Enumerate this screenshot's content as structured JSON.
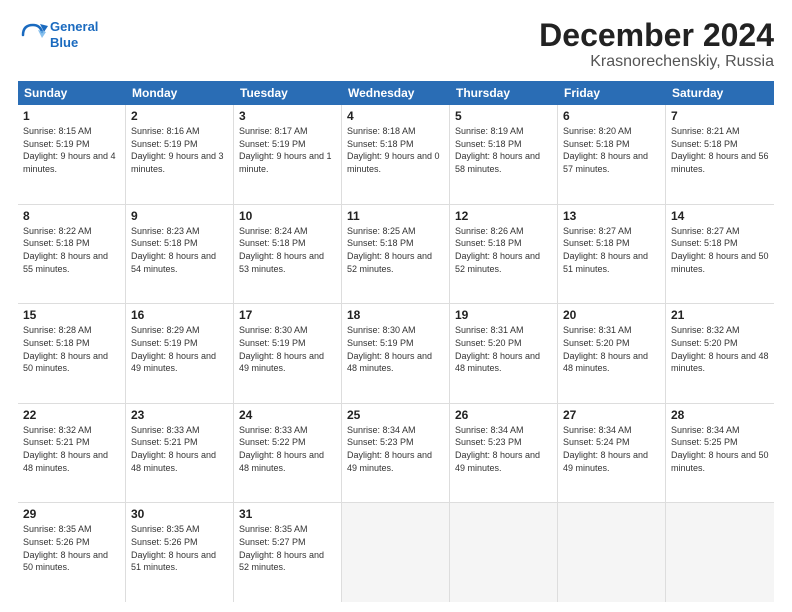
{
  "logo": {
    "line1": "General",
    "line2": "Blue"
  },
  "title": "December 2024",
  "subtitle": "Krasnorechenskiy, Russia",
  "header": {
    "days": [
      "Sunday",
      "Monday",
      "Tuesday",
      "Wednesday",
      "Thursday",
      "Friday",
      "Saturday"
    ]
  },
  "weeks": [
    [
      {
        "day": "1",
        "sunrise": "8:15 AM",
        "sunset": "5:19 PM",
        "daylight": "9 hours and 4 minutes."
      },
      {
        "day": "2",
        "sunrise": "8:16 AM",
        "sunset": "5:19 PM",
        "daylight": "9 hours and 3 minutes."
      },
      {
        "day": "3",
        "sunrise": "8:17 AM",
        "sunset": "5:19 PM",
        "daylight": "9 hours and 1 minute."
      },
      {
        "day": "4",
        "sunrise": "8:18 AM",
        "sunset": "5:18 PM",
        "daylight": "9 hours and 0 minutes."
      },
      {
        "day": "5",
        "sunrise": "8:19 AM",
        "sunset": "5:18 PM",
        "daylight": "8 hours and 58 minutes."
      },
      {
        "day": "6",
        "sunrise": "8:20 AM",
        "sunset": "5:18 PM",
        "daylight": "8 hours and 57 minutes."
      },
      {
        "day": "7",
        "sunrise": "8:21 AM",
        "sunset": "5:18 PM",
        "daylight": "8 hours and 56 minutes."
      }
    ],
    [
      {
        "day": "8",
        "sunrise": "8:22 AM",
        "sunset": "5:18 PM",
        "daylight": "8 hours and 55 minutes."
      },
      {
        "day": "9",
        "sunrise": "8:23 AM",
        "sunset": "5:18 PM",
        "daylight": "8 hours and 54 minutes."
      },
      {
        "day": "10",
        "sunrise": "8:24 AM",
        "sunset": "5:18 PM",
        "daylight": "8 hours and 53 minutes."
      },
      {
        "day": "11",
        "sunrise": "8:25 AM",
        "sunset": "5:18 PM",
        "daylight": "8 hours and 52 minutes."
      },
      {
        "day": "12",
        "sunrise": "8:26 AM",
        "sunset": "5:18 PM",
        "daylight": "8 hours and 52 minutes."
      },
      {
        "day": "13",
        "sunrise": "8:27 AM",
        "sunset": "5:18 PM",
        "daylight": "8 hours and 51 minutes."
      },
      {
        "day": "14",
        "sunrise": "8:27 AM",
        "sunset": "5:18 PM",
        "daylight": "8 hours and 50 minutes."
      }
    ],
    [
      {
        "day": "15",
        "sunrise": "8:28 AM",
        "sunset": "5:18 PM",
        "daylight": "8 hours and 50 minutes."
      },
      {
        "day": "16",
        "sunrise": "8:29 AM",
        "sunset": "5:19 PM",
        "daylight": "8 hours and 49 minutes."
      },
      {
        "day": "17",
        "sunrise": "8:30 AM",
        "sunset": "5:19 PM",
        "daylight": "8 hours and 49 minutes."
      },
      {
        "day": "18",
        "sunrise": "8:30 AM",
        "sunset": "5:19 PM",
        "daylight": "8 hours and 48 minutes."
      },
      {
        "day": "19",
        "sunrise": "8:31 AM",
        "sunset": "5:20 PM",
        "daylight": "8 hours and 48 minutes."
      },
      {
        "day": "20",
        "sunrise": "8:31 AM",
        "sunset": "5:20 PM",
        "daylight": "8 hours and 48 minutes."
      },
      {
        "day": "21",
        "sunrise": "8:32 AM",
        "sunset": "5:20 PM",
        "daylight": "8 hours and 48 minutes."
      }
    ],
    [
      {
        "day": "22",
        "sunrise": "8:32 AM",
        "sunset": "5:21 PM",
        "daylight": "8 hours and 48 minutes."
      },
      {
        "day": "23",
        "sunrise": "8:33 AM",
        "sunset": "5:21 PM",
        "daylight": "8 hours and 48 minutes."
      },
      {
        "day": "24",
        "sunrise": "8:33 AM",
        "sunset": "5:22 PM",
        "daylight": "8 hours and 48 minutes."
      },
      {
        "day": "25",
        "sunrise": "8:34 AM",
        "sunset": "5:23 PM",
        "daylight": "8 hours and 49 minutes."
      },
      {
        "day": "26",
        "sunrise": "8:34 AM",
        "sunset": "5:23 PM",
        "daylight": "8 hours and 49 minutes."
      },
      {
        "day": "27",
        "sunrise": "8:34 AM",
        "sunset": "5:24 PM",
        "daylight": "8 hours and 49 minutes."
      },
      {
        "day": "28",
        "sunrise": "8:34 AM",
        "sunset": "5:25 PM",
        "daylight": "8 hours and 50 minutes."
      }
    ],
    [
      {
        "day": "29",
        "sunrise": "8:35 AM",
        "sunset": "5:26 PM",
        "daylight": "8 hours and 50 minutes."
      },
      {
        "day": "30",
        "sunrise": "8:35 AM",
        "sunset": "5:26 PM",
        "daylight": "8 hours and 51 minutes."
      },
      {
        "day": "31",
        "sunrise": "8:35 AM",
        "sunset": "5:27 PM",
        "daylight": "8 hours and 52 minutes."
      },
      null,
      null,
      null,
      null
    ]
  ]
}
